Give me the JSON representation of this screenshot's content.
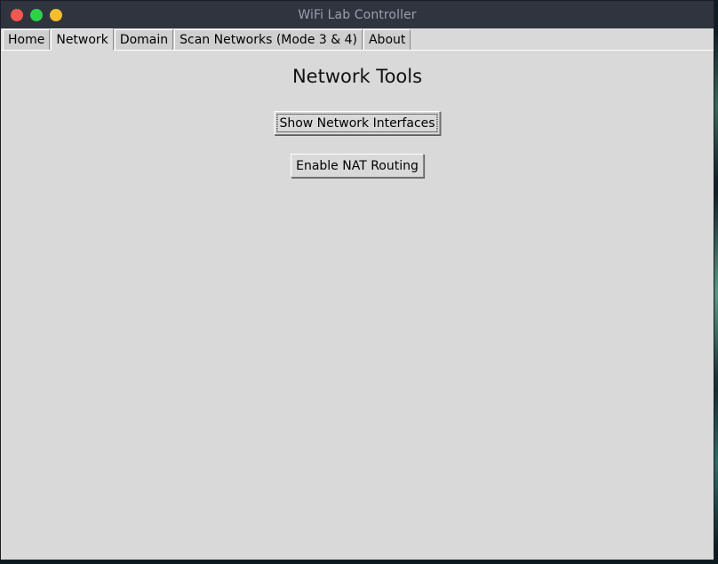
{
  "window": {
    "title": "WiFi Lab Controller"
  },
  "tabs": [
    {
      "label": "Home",
      "active": false
    },
    {
      "label": "Network",
      "active": true
    },
    {
      "label": "Domain",
      "active": false
    },
    {
      "label": "Scan Networks (Mode 3 & 4)",
      "active": false
    },
    {
      "label": "About",
      "active": false
    }
  ],
  "main": {
    "heading": "Network Tools",
    "buttons": [
      {
        "label": "Show Network Interfaces"
      },
      {
        "label": "Enable NAT Routing"
      }
    ]
  },
  "colors": {
    "titlebar": "#2f343f",
    "window_bg": "#d9d9d9",
    "close": "#f5584e",
    "maximize": "#2fd04a",
    "minimize": "#f8bd2c"
  }
}
